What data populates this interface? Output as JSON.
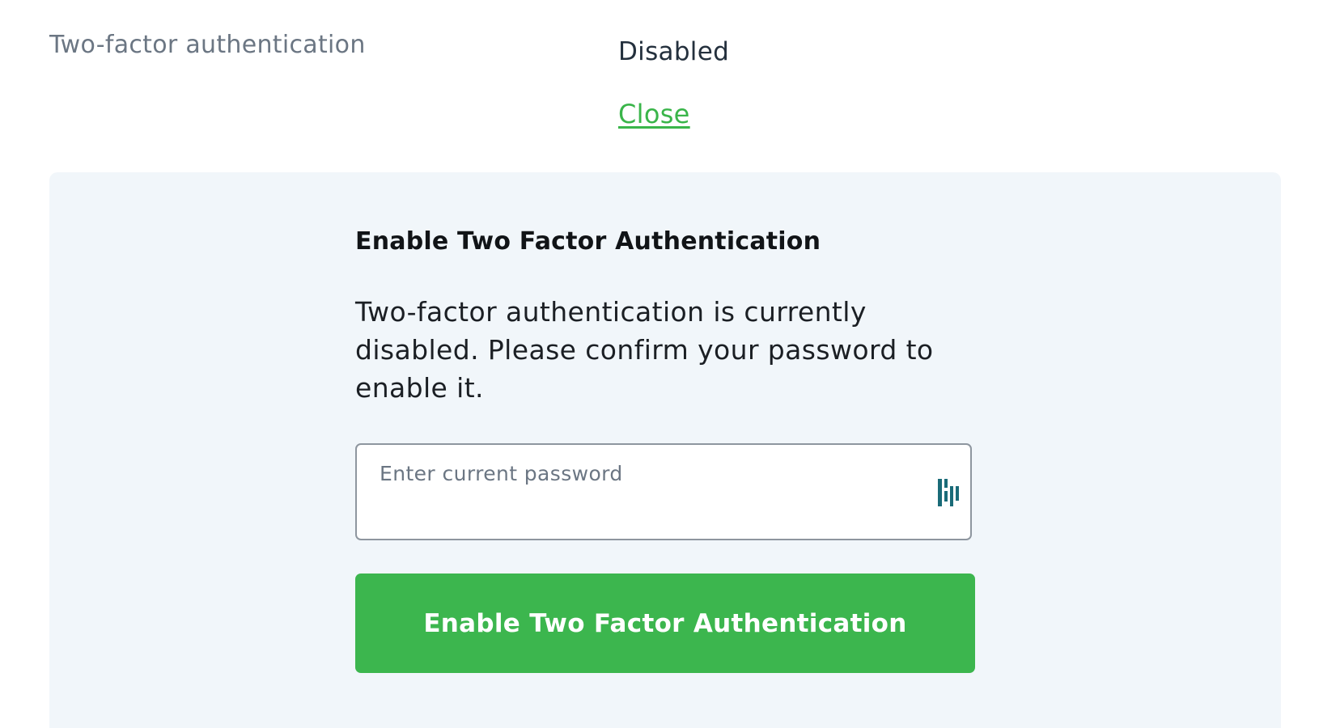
{
  "setting": {
    "label": "Two-factor authentication",
    "status": "Disabled",
    "close_link": "Close"
  },
  "enable_panel": {
    "title": "Enable Two Factor Authentication",
    "description": "Two-factor authentication is currently disabled. Please confirm your password to enable it.",
    "password_placeholder": "Enter current password",
    "password_value": "",
    "password_manager_icon": "dashlane-icon",
    "submit_label": "Enable Two Factor Authentication"
  },
  "colors": {
    "accent_green": "#3cb64e",
    "link_green": "#3ab54a",
    "panel_background": "#f1f6fa",
    "icon_teal": "#1a6b78"
  }
}
